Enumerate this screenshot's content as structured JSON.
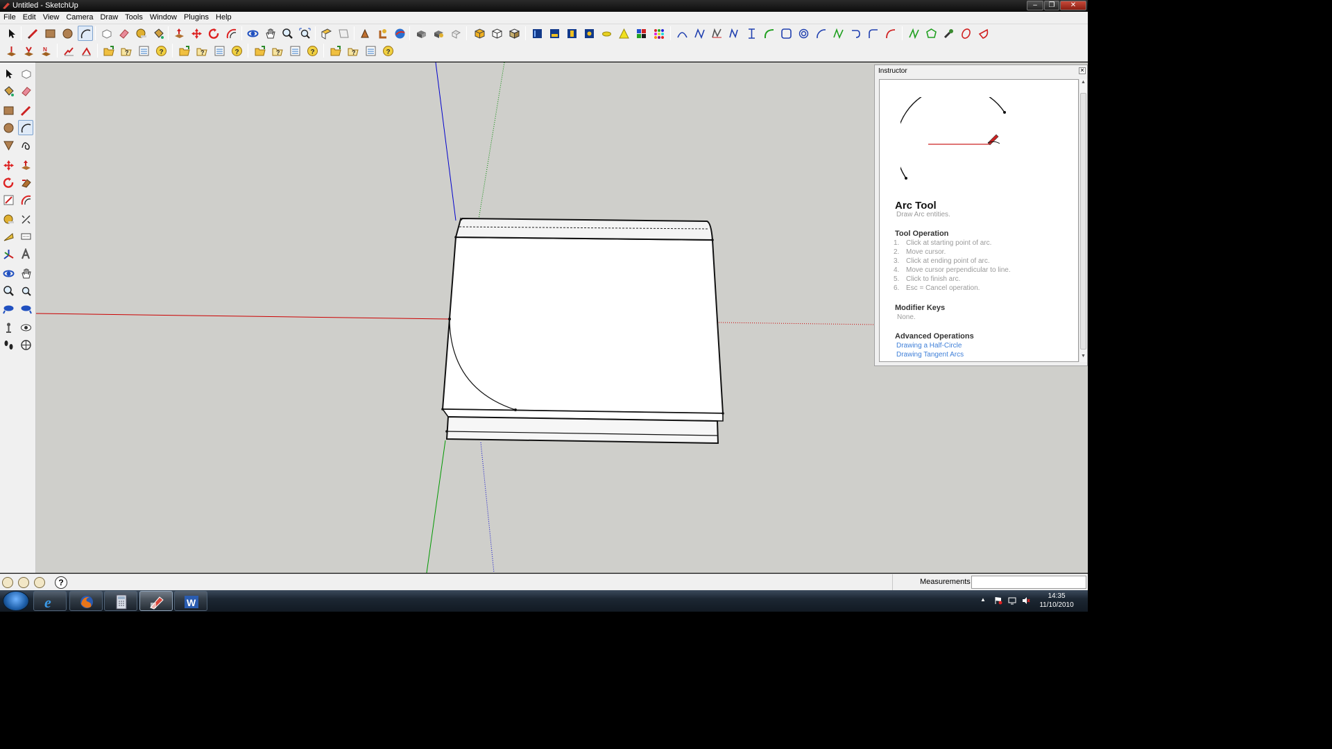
{
  "window": {
    "title": "Untitled - SketchUp"
  },
  "menu": [
    "File",
    "Edit",
    "View",
    "Camera",
    "Draw",
    "Tools",
    "Window",
    "Plugins",
    "Help"
  ],
  "instructor": {
    "panel_title": "Instructor",
    "tool_title": "Arc Tool",
    "tool_subtitle": "Draw Arc entities.",
    "operation_heading": "Tool Operation",
    "steps": [
      {
        "num": "1.",
        "text": "Click at starting point of arc."
      },
      {
        "num": "2.",
        "text": "Move cursor."
      },
      {
        "num": "3.",
        "text": "Click at ending point of arc."
      },
      {
        "num": "4.",
        "text": "Move cursor perpendicular to line."
      },
      {
        "num": "5.",
        "text": "Click to finish arc."
      },
      {
        "num": "6.",
        "text": "Esc = Cancel operation."
      }
    ],
    "modifier_heading": "Modifier Keys",
    "modifier_text": "None.",
    "advanced_heading": "Advanced Operations",
    "links": [
      "Drawing a Half-Circle",
      "Drawing Tangent Arcs"
    ]
  },
  "statusbar": {
    "measurements_label": "Measurements",
    "measurements_value": "",
    "help_label": "?"
  },
  "taskbar": {
    "time": "14:35",
    "date": "11/10/2010"
  },
  "colors": {
    "red_axis": "#cc0000",
    "green_axis": "#009900",
    "blue_axis": "#0000cc",
    "viewport_bg": "#cfcfcb",
    "link": "#3e7fd8"
  }
}
